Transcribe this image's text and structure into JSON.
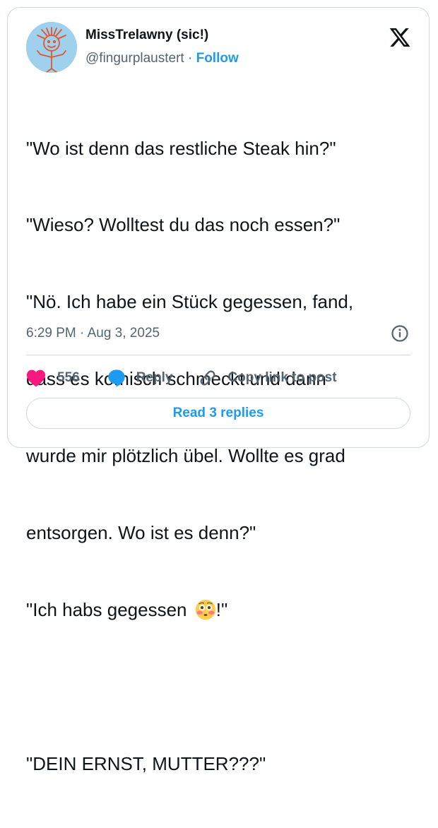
{
  "author": {
    "display_name": "MissTrelawny (sic!)",
    "handle": "@fingurplaustert",
    "separator": " · ",
    "follow_label": "Follow"
  },
  "tweet": {
    "lines": [
      "\"Wo ist denn das restliche Steak hin?\"",
      "\"Wieso? Wolltest du das noch essen?\"",
      "\"Nö. Ich habe ein Stück gegessen, fand,",
      "dass es komisch schmeckt und dann",
      "wurde mir plötzlich übel. Wollte es grad",
      "entsorgen. Wo ist es denn?\"",
      "\"Ich habs gegessen ",
      "!\"",
      "",
      "\"DEIN ERNST, MUTTER???\""
    ]
  },
  "timestamp": "6:29 PM · Aug 3, 2025",
  "actions": {
    "like_count": "556",
    "reply_label": "Reply",
    "copy_link_label": "Copy link to post"
  },
  "read_replies_label": "Read 3 replies",
  "icons": {
    "logo": "x-logo-icon",
    "info": "info-icon",
    "like": "heart-icon",
    "reply": "speech-bubble-icon",
    "copy": "link-icon",
    "emoji": "flushed-face-emoji"
  },
  "colors": {
    "accent": "#1d9bf0",
    "like": "#f91880",
    "text": "#0f1419",
    "muted": "#536471",
    "border": "#cfd9de"
  }
}
